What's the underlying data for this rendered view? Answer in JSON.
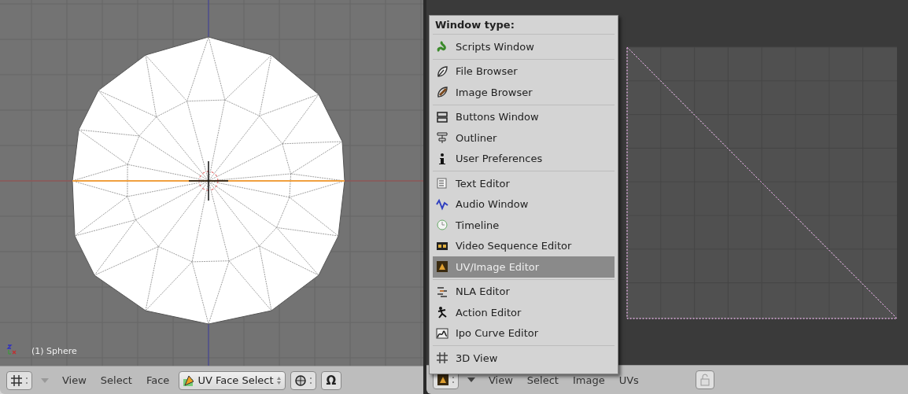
{
  "viewport_3d": {
    "object_label": "(1) Sphere"
  },
  "header_3d": {
    "menus": [
      "View",
      "Select",
      "Face"
    ],
    "mode": "UV Face Select",
    "omega_button": "Ω"
  },
  "window_type_menu": {
    "title": "Window type:",
    "groups": [
      [
        {
          "label": "Scripts Window",
          "selected": false
        }
      ],
      [
        {
          "label": "File Browser",
          "selected": false
        },
        {
          "label": "Image Browser",
          "selected": false
        }
      ],
      [
        {
          "label": "Buttons Window",
          "selected": false
        },
        {
          "label": "Outliner",
          "selected": false
        },
        {
          "label": "User Preferences",
          "selected": false
        }
      ],
      [
        {
          "label": "Text Editor",
          "selected": false
        },
        {
          "label": "Audio Window",
          "selected": false
        },
        {
          "label": "Timeline",
          "selected": false
        },
        {
          "label": "Video Sequence Editor",
          "selected": false
        },
        {
          "label": "UV/Image Editor",
          "selected": true
        }
      ],
      [
        {
          "label": "NLA Editor",
          "selected": false
        },
        {
          "label": "Action Editor",
          "selected": false
        },
        {
          "label": "Ipo Curve Editor",
          "selected": false
        }
      ],
      [
        {
          "label": "3D View",
          "selected": false
        }
      ]
    ]
  },
  "header_uv": {
    "menus": [
      "View",
      "Select",
      "Image",
      "UVs"
    ]
  }
}
